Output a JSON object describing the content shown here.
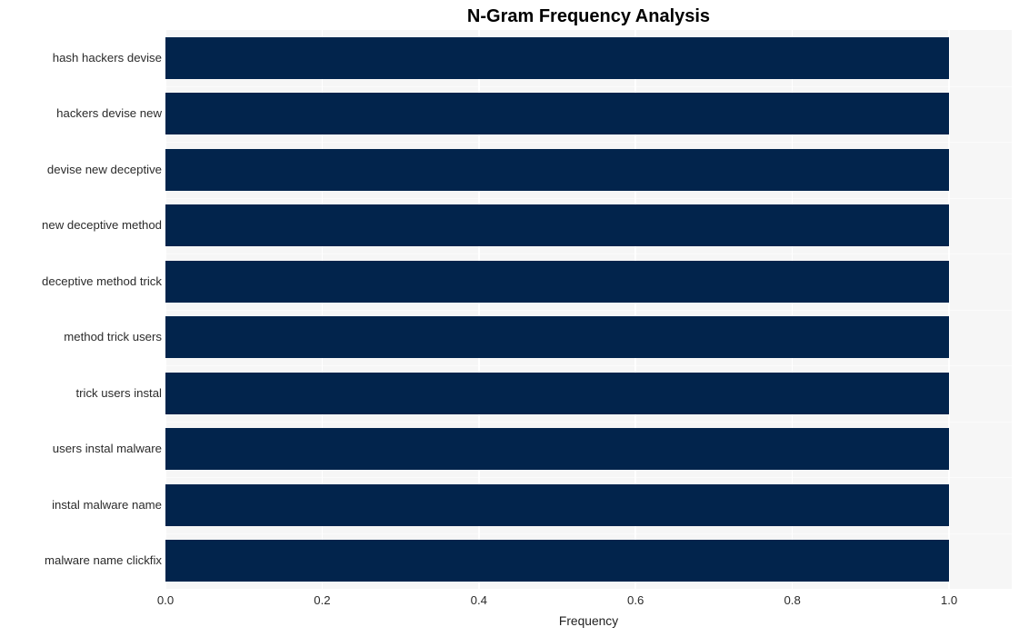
{
  "chart_data": {
    "type": "bar",
    "orientation": "horizontal",
    "title": "N-Gram Frequency Analysis",
    "xlabel": "Frequency",
    "ylabel": "",
    "categories": [
      "hash hackers devise",
      "hackers devise new",
      "devise new deceptive",
      "new deceptive method",
      "deceptive method trick",
      "method trick users",
      "trick users instal",
      "users instal malware",
      "instal malware name",
      "malware name clickfix"
    ],
    "values": [
      1.0,
      1.0,
      1.0,
      1.0,
      1.0,
      1.0,
      1.0,
      1.0,
      1.0,
      1.0
    ],
    "xlim": [
      0.0,
      1.08
    ],
    "xticks": [
      0.0,
      0.2,
      0.4,
      0.6,
      0.8,
      1.0
    ],
    "xtick_labels": [
      "0.0",
      "0.2",
      "0.4",
      "0.6",
      "0.8",
      "1.0"
    ],
    "grid": true,
    "legend": false,
    "bar_color": "#02244c",
    "plot_background": "#f6f6f6",
    "gridline_color": "#ffffff",
    "figure_background": "#ffffff",
    "text_color": "#2b2b2b"
  }
}
